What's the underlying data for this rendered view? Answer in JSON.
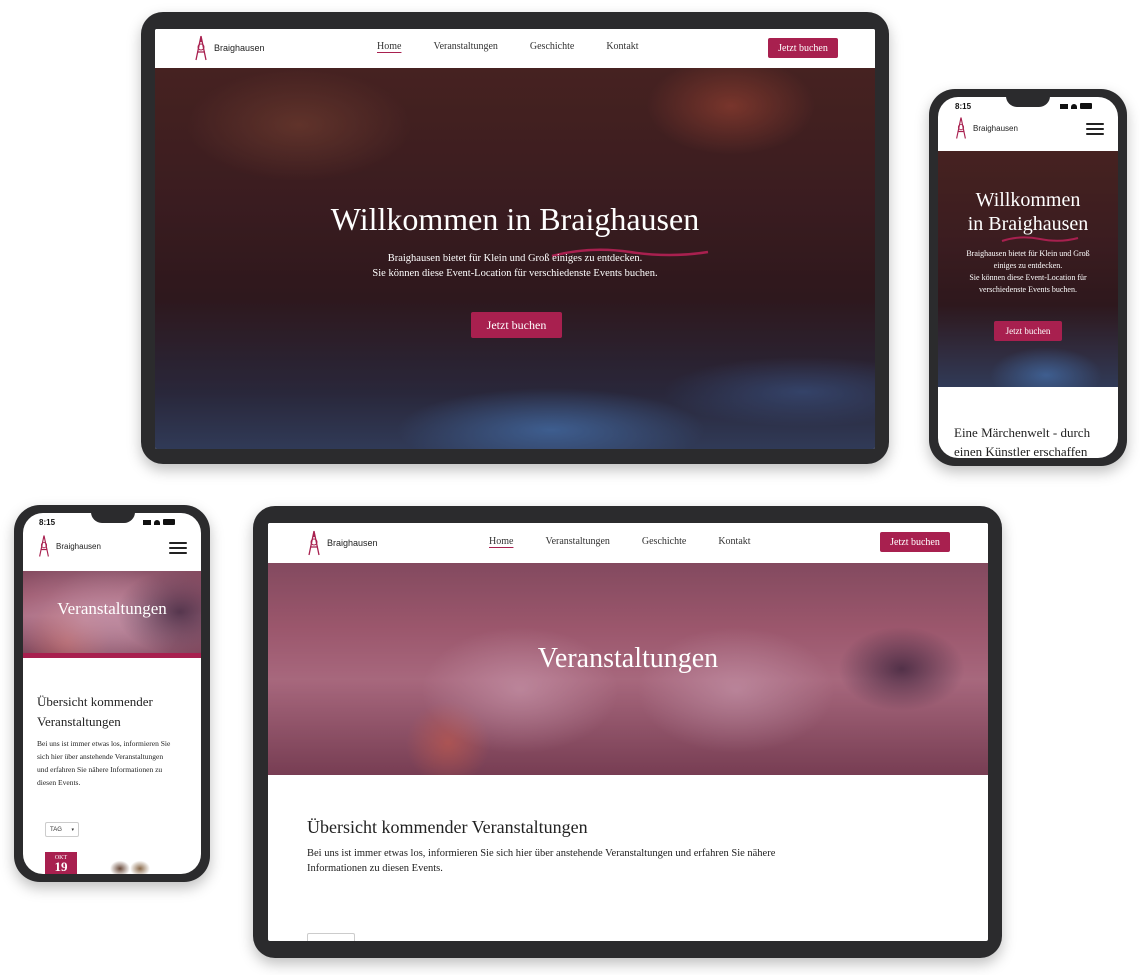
{
  "brand": {
    "name": "Braighausen",
    "accent": "#a8204f"
  },
  "nav": {
    "links": [
      "Home",
      "Veranstaltungen",
      "Geschichte",
      "Kontakt"
    ],
    "cta": "Jetzt buchen"
  },
  "status_bar": {
    "time": "8:15"
  },
  "home": {
    "title": "Willkommen in Braighausen",
    "title_mobile_line1": "Willkommen",
    "title_mobile_line2": "in Braighausen",
    "subtitle_line1": "Braighausen bietet für Klein und Groß einiges zu entdecken.",
    "subtitle_line2": "Sie können diese Event-Location für verschiedenste Events buchen.",
    "subtitle_mobile_lines": [
      "Braighausen bietet für Klein und Groß",
      "einiges zu entdecken.",
      "Sie können diese Event-Location für",
      "verschiedenste Events buchen."
    ],
    "cta": "Jetzt buchen",
    "section_mobile_line1": "Eine Märchenwelt - durch",
    "section_mobile_line2": "einen Künstler erschaffen"
  },
  "events": {
    "title": "Veranstaltungen",
    "overview_title": "Übersicht kommender Veranstaltungen",
    "overview_title_mobile_line1": "Übersicht kommender",
    "overview_title_mobile_line2": "Veranstaltungen",
    "overview_text_line1": "Bei uns ist immer etwas los, informieren Sie sich hier über anstehende Veranstaltungen und erfahren Sie nähere",
    "overview_text_line2": "Informationen zu diesen Events.",
    "overview_text_mobile_lines": [
      "Bei uns ist immer etwas los, informieren Sie",
      "sich hier über anstehende Veranstaltungen",
      "und erfahren Sie nähere Informationen zu",
      "diesen Events."
    ],
    "filter_label": "TAG",
    "date_month": "OKT",
    "date_day": "19"
  }
}
